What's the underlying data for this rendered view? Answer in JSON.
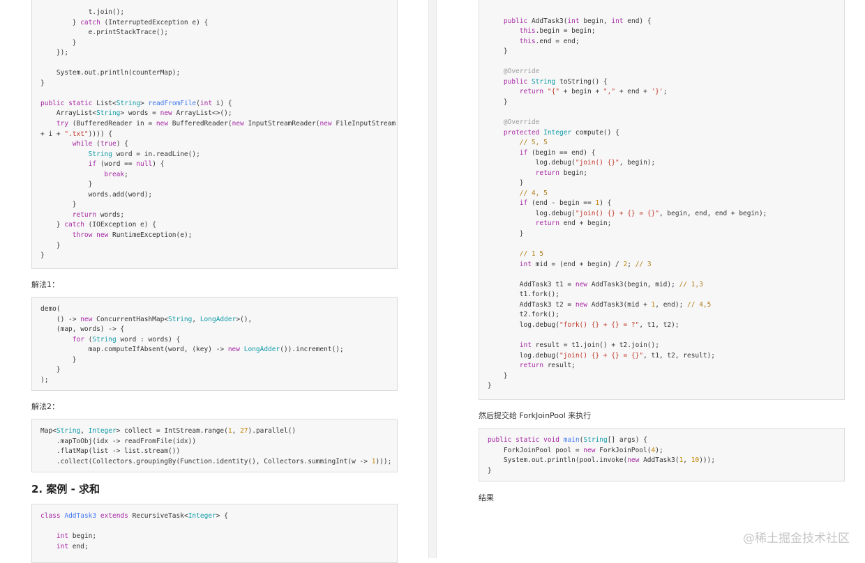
{
  "left": {
    "code_block_1": [
      "            t.join();",
      "        } catch (InterruptedException e) {",
      "            e.printStackTrace();",
      "        }",
      "    });",
      "",
      "    System.out.println(counterMap);",
      "}",
      "",
      "public static List<String> readFromFile(int i) {",
      "    ArrayList<String> words = new ArrayList<>();",
      "    try (BufferedReader in = new BufferedReader(new InputStreamReader(new FileInputStream(\"tmp/\"",
      "+ i + \".txt\")))) {",
      "        while (true) {",
      "            String word = in.readLine();",
      "            if (word == null) {",
      "                break;",
      "            }",
      "            words.add(word);",
      "        }",
      "        return words;",
      "    } catch (IOException e) {",
      "        throw new RuntimeException(e);",
      "    }",
      "}"
    ],
    "label_solution_1": "解法1：",
    "code_block_2": [
      "demo(",
      "    () -> new ConcurrentHashMap<String, LongAdder>(),",
      "    (map, words) -> {",
      "        for (String word : words) {",
      "            map.computeIfAbsent(word, (key) -> new LongAdder()).increment();",
      "        }",
      "    }",
      ");"
    ],
    "label_solution_2": "解法2：",
    "code_block_3": [
      "Map<String, Integer> collect = IntStream.range(1, 27).parallel()",
      "    .mapToObj(idx -> readFromFile(idx))",
      "    .flatMap(list -> list.stream())",
      "    .collect(Collectors.groupingBy(Function.identity(), Collectors.summingInt(w -> 1)));"
    ],
    "heading": "2. 案例 - 求和",
    "code_block_4": [
      "class AddTask3 extends RecursiveTask<Integer> {",
      "",
      "    int begin;",
      "    int end;"
    ]
  },
  "right": {
    "code_block_1": [
      "",
      "    public AddTask3(int begin, int end) {",
      "        this.begin = begin;",
      "        this.end = end;",
      "    }",
      "",
      "    @Override",
      "    public String toString() {",
      "        return \"{\" + begin + \",\" + end + '}';",
      "    }",
      "",
      "    @Override",
      "    protected Integer compute() {",
      "        // 5, 5",
      "        if (begin == end) {",
      "            log.debug(\"join() {}\", begin);",
      "            return begin;",
      "        }",
      "        // 4, 5",
      "        if (end - begin == 1) {",
      "            log.debug(\"join() {} + {} = {}\", begin, end, end + begin);",
      "            return end + begin;",
      "        }",
      "",
      "        // 1 5",
      "        int mid = (end + begin) / 2; // 3",
      "",
      "        AddTask3 t1 = new AddTask3(begin, mid); // 1,3",
      "        t1.fork();",
      "        AddTask3 t2 = new AddTask3(mid + 1, end); // 4,5",
      "        t2.fork();",
      "        log.debug(\"fork() {} + {} = ?\", t1, t2);",
      "",
      "        int result = t1.join() + t2.join();",
      "        log.debug(\"join() {} + {} = {}\", t1, t2, result);",
      "        return result;",
      "    }",
      "}"
    ],
    "label_submit": "然后提交给 ForkJoinPool 来执行",
    "code_block_2": [
      "public static void main(String[] args) {",
      "    ForkJoinPool pool = new ForkJoinPool(4);",
      "    System.out.println(pool.invoke(new AddTask3(1, 10)));",
      "}"
    ],
    "label_result": "结果"
  },
  "watermark": "@稀土掘金技术社区"
}
